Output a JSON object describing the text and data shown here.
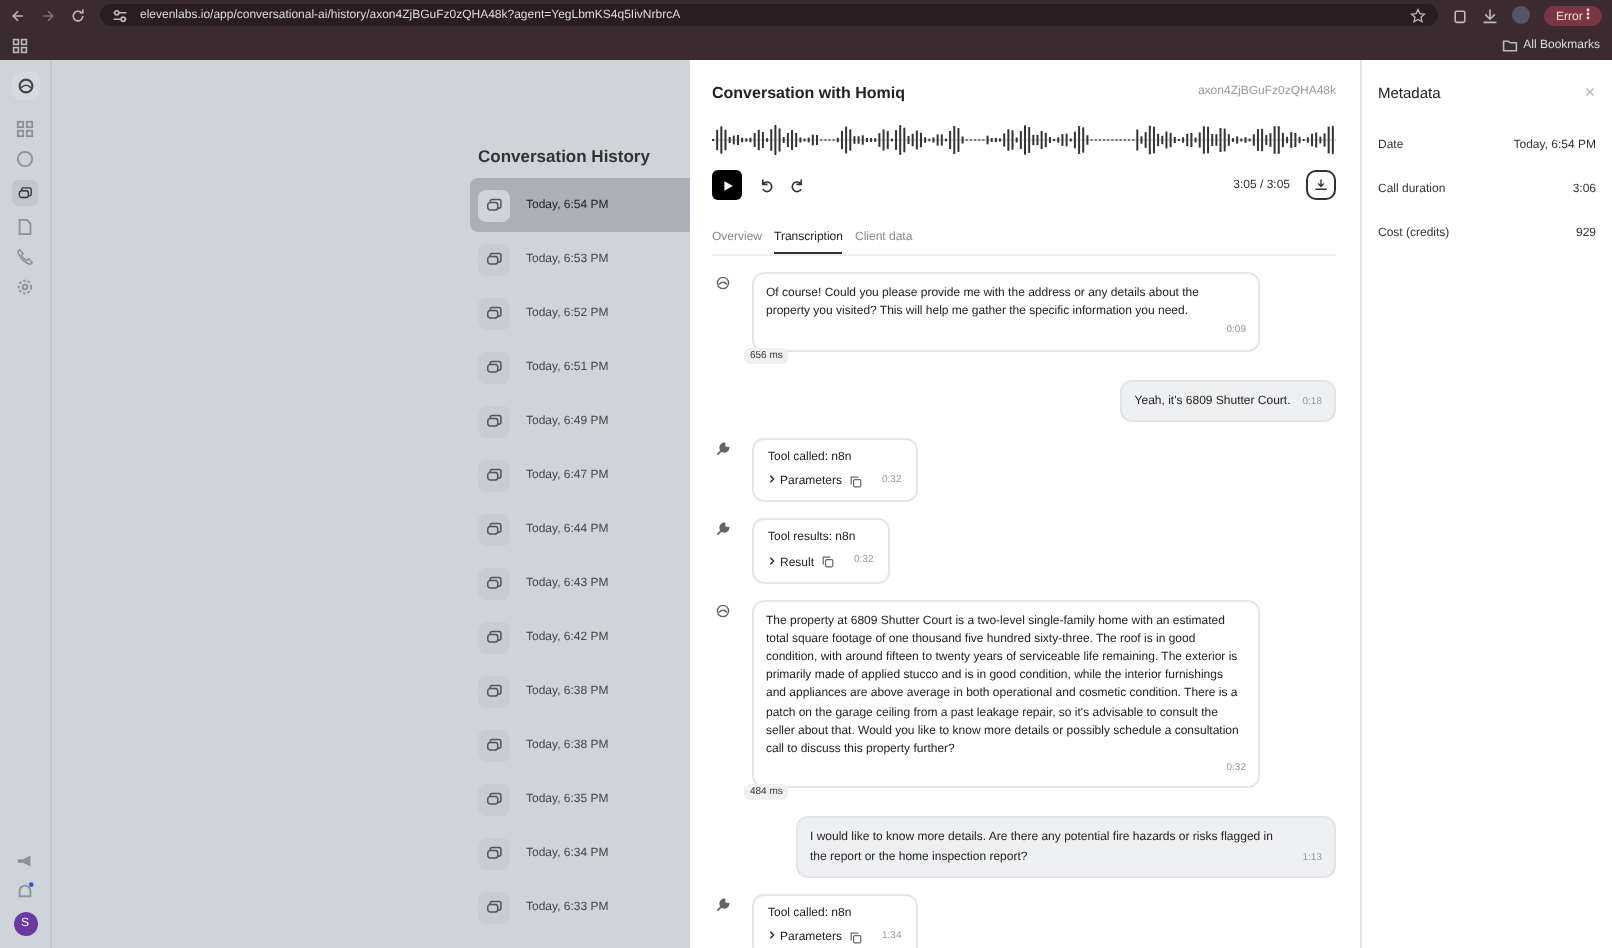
{
  "browser": {
    "url": "elevenlabs.io/app/conversational-ai/history/axon4ZjBGuFz0zQHA48k?agent=YegLbmKS4q5IivNrbrcA",
    "error_label": "Error",
    "bookmarks_label": "All Bookmarks"
  },
  "sidebar": {
    "avatar_letter": "S"
  },
  "history": {
    "title": "Conversation History",
    "items": [
      {
        "time": "Today, 6:54 PM",
        "selected": true
      },
      {
        "time": "Today, 6:53 PM",
        "selected": false
      },
      {
        "time": "Today, 6:52 PM",
        "selected": false
      },
      {
        "time": "Today, 6:51 PM",
        "selected": false
      },
      {
        "time": "Today, 6:49 PM",
        "selected": false
      },
      {
        "time": "Today, 6:47 PM",
        "selected": false
      },
      {
        "time": "Today, 6:44 PM",
        "selected": false
      },
      {
        "time": "Today, 6:43 PM",
        "selected": false
      },
      {
        "time": "Today, 6:42 PM",
        "selected": false
      },
      {
        "time": "Today, 6:38 PM",
        "selected": false
      },
      {
        "time": "Today, 6:38 PM",
        "selected": false
      },
      {
        "time": "Today, 6:35 PM",
        "selected": false
      },
      {
        "time": "Today, 6:34 PM",
        "selected": false
      },
      {
        "time": "Today, 6:33 PM",
        "selected": false
      }
    ]
  },
  "conversation": {
    "title": "Conversation with Homiq",
    "id": "axon4ZjBGuFz0zQHA48k",
    "playback_time": "3:05 / 3:05",
    "tabs": [
      {
        "label": "Overview",
        "selected": false
      },
      {
        "label": "Transcription",
        "selected": true
      },
      {
        "label": "Client data",
        "selected": false
      }
    ],
    "messages": [
      {
        "kind": "agent",
        "text": "Of course! Could you please provide me with the address or any details about the property you visited? This will help me gather the specific information you need.",
        "time": "0:09",
        "latency": "656 ms"
      },
      {
        "kind": "user",
        "text": "Yeah, it's 6809 Shutter Court.",
        "time": "0:18"
      },
      {
        "kind": "tool",
        "text": "Tool called: n8n",
        "toggle": "Parameters",
        "time": "0:32"
      },
      {
        "kind": "tool",
        "text": "Tool results: n8n",
        "toggle": "Result",
        "time": "0:32"
      },
      {
        "kind": "agent",
        "text": "The property at 6809 Shutter Court is a two-level single-family home with an estimated total square footage of one thousand five hundred sixty-three. The roof is in good condition, with around fifteen to twenty years of serviceable life remaining. The exterior is primarily made of applied stucco and is in good condition, while the interior furnishings and appliances are above average in both operational and cosmetic condition. There is a patch on the garage ceiling from a past leakage repair, so it's advisable to consult the seller about that. Would you like to know more details or possibly schedule a consultation call to discuss this property further?",
        "time": "0:32",
        "latency": "484 ms"
      },
      {
        "kind": "user",
        "text": "I would like to know more details. Are there any potential fire hazards or risks flagged in the report or the home inspection report?",
        "time": "1:13"
      },
      {
        "kind": "tool",
        "text": "Tool called: n8n",
        "toggle": "Parameters",
        "time": "1:34"
      }
    ]
  },
  "metadata": {
    "title": "Metadata",
    "rows": [
      {
        "label": "Date",
        "value": "Today, 6:54 PM"
      },
      {
        "label": "Call duration",
        "value": "3:06"
      },
      {
        "label": "Cost (credits)",
        "value": "929"
      }
    ]
  }
}
